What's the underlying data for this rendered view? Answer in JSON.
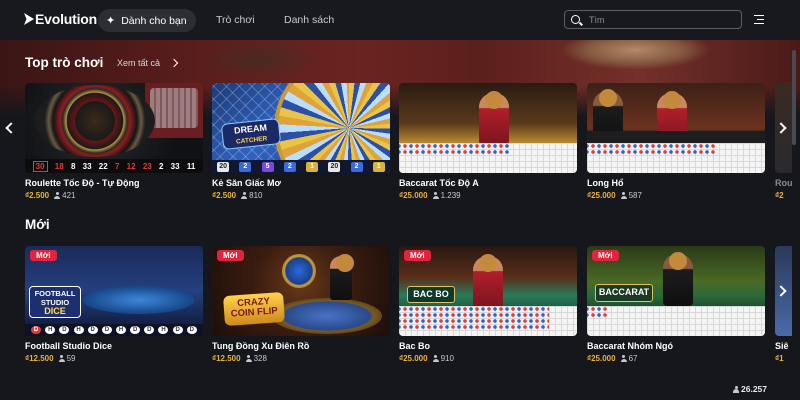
{
  "header": {
    "logo_text": "Evolution",
    "nav": [
      {
        "label": "Dành cho bạn",
        "active": true
      },
      {
        "label": "Trò chơi",
        "active": false
      },
      {
        "label": "Danh sách",
        "active": false
      }
    ],
    "search_placeholder": "Tìm"
  },
  "top_games": {
    "title": "Top trò chơi",
    "see_all": "Xem tất cả",
    "cards": [
      {
        "name": "Roulette Tốc Độ - Tự Động",
        "price": "₫2.500",
        "players": "421",
        "numbers": [
          "30",
          "18",
          "8",
          "33",
          "22",
          "7",
          "12",
          "23",
          "2",
          "33",
          "11"
        ]
      },
      {
        "name": "Kẻ Săn Giấc Mơ",
        "price": "₫2.500",
        "players": "810",
        "logo_line1": "DREAM",
        "logo_line2": "CATCHER",
        "results": [
          "20",
          "2",
          "5",
          "2",
          "1",
          "20",
          "2",
          "1"
        ]
      },
      {
        "name": "Baccarat Tốc Độ A",
        "price": "₫25.000",
        "players": "1.239"
      },
      {
        "name": "Long Hổ",
        "price": "₫25.000",
        "players": "587"
      },
      {
        "name": "Rou",
        "price": "₫2"
      }
    ]
  },
  "new_games": {
    "title": "Mới",
    "badge": "Mới",
    "cards": [
      {
        "name": "Football Studio Dice",
        "price": "₫12.500",
        "players": "59",
        "logo_line1": "FOOTBALL",
        "logo_line2": "STUDIO",
        "logo_line3": "DICE",
        "results": [
          "D",
          "H",
          "D",
          "H",
          "D",
          "D",
          "H",
          "D",
          "D",
          "H",
          "D",
          "D"
        ]
      },
      {
        "name": "Tung Đồng Xu Điên Rồ",
        "price": "₫12.500",
        "players": "328",
        "logo_line1": "CRAZY",
        "logo_line2": "COIN",
        "logo_line3": "FLIP"
      },
      {
        "name": "Bac Bo",
        "price": "₫25.000",
        "players": "910",
        "logo": "BAC BO"
      },
      {
        "name": "Baccarat Nhóm Ngó",
        "price": "₫25.000",
        "players": "67",
        "logo": "BACCARAT"
      },
      {
        "name": "Siê",
        "price": "₫1"
      }
    ]
  },
  "footer": {
    "players": "26.257"
  },
  "colors": {
    "accent_gold": "#e8b23a",
    "badge_red": "#e0243d",
    "background": "#16171c"
  }
}
